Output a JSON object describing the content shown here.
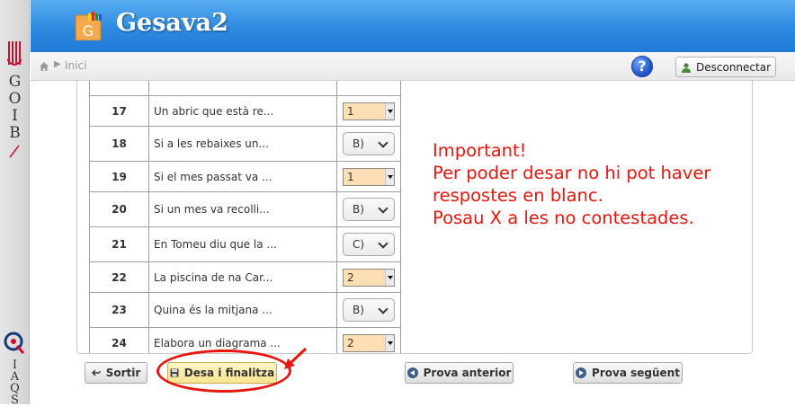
{
  "app": {
    "title": "Gesava2",
    "logo_letter": "G"
  },
  "rail": {
    "goib_letters": [
      "G",
      "O",
      "I",
      "B"
    ],
    "iaqs_letters": [
      "I",
      "A",
      "Q",
      "S"
    ]
  },
  "breadcrumb": {
    "home_icon": "home-icon",
    "current": "Inici"
  },
  "header_actions": {
    "help_symbol": "?",
    "logout_label": "Desconnectar"
  },
  "questions": [
    {
      "num": "17",
      "text": "Un abric que està re...",
      "answer": "1",
      "style": "small"
    },
    {
      "num": "18",
      "text": "Si a les rebaixes un...",
      "answer": "B)",
      "style": "big"
    },
    {
      "num": "19",
      "text": "Si el mes passat va ...",
      "answer": "1",
      "style": "small"
    },
    {
      "num": "20",
      "text": "Si un mes va recolli...",
      "answer": "B)",
      "style": "big"
    },
    {
      "num": "21",
      "text": "En Tomeu diu que la ...",
      "answer": "C)",
      "style": "big"
    },
    {
      "num": "22",
      "text": "La piscina de na Car...",
      "answer": "2",
      "style": "small"
    },
    {
      "num": "23",
      "text": "Quina és la mitjana ...",
      "answer": "B)",
      "style": "big"
    },
    {
      "num": "24",
      "text": "Elabora un diagrama ...",
      "answer": "2",
      "style": "small"
    }
  ],
  "notice": {
    "line1": "Important!",
    "line2": "Per poder desar no hi pot haver",
    "line3": "respostes en blanc.",
    "line4": "Posau X a les no contestades."
  },
  "buttons": {
    "back": "Sortir",
    "save": "Desa i finalitza",
    "prev": "Prova anterior",
    "next": "Prova següent"
  },
  "colors": {
    "header_blue": "#2d8ae0",
    "notice_red": "#e8160c",
    "select_orange": "#fddfb6",
    "save_yellow": "#fbe38e"
  }
}
